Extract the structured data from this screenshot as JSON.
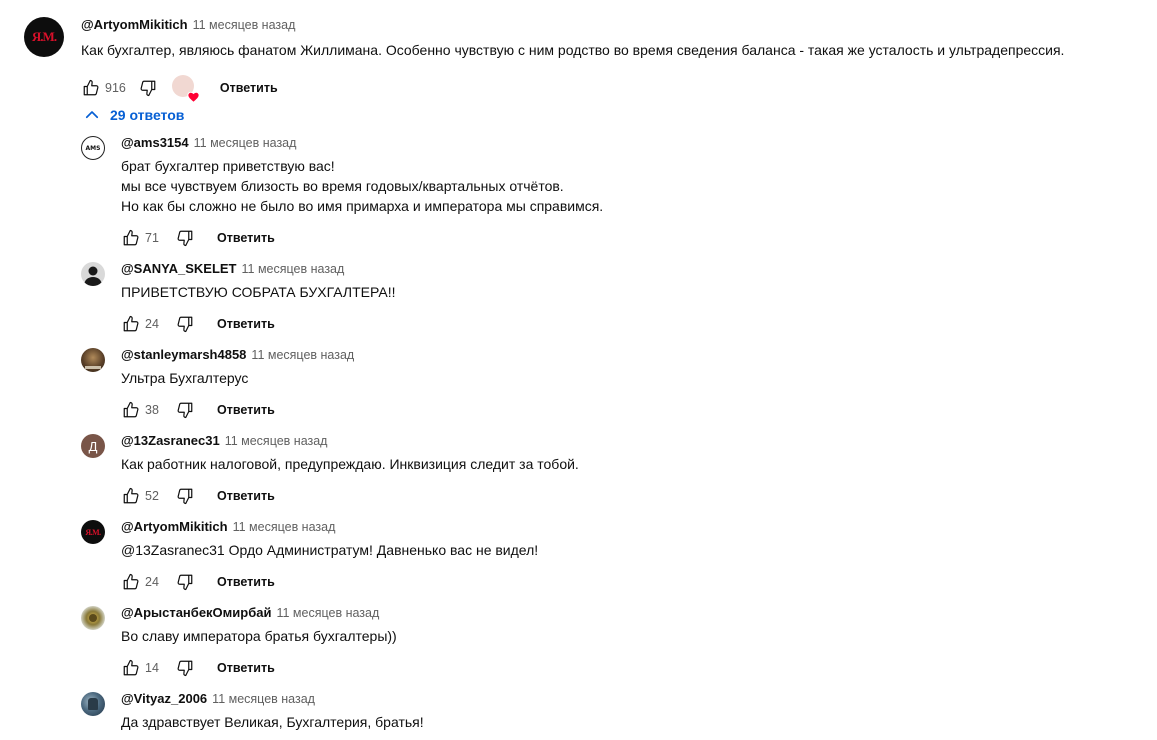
{
  "main_comment": {
    "author": "@ArtyomMikitich",
    "time": "11 месяцев назад",
    "text": "Как бухгалтер, являюсь фанатом Жиллимана. Особенно чувствую с ним родство во время сведения баланса - такая же усталость и ультрадепрессия.",
    "likes": "916",
    "reply_label": "Ответить",
    "avatar_logo": "Я.М."
  },
  "replies_toggle": {
    "label": "29 ответов"
  },
  "replies": [
    {
      "author": "@ams3154",
      "time": "11 месяцев назад",
      "text": "брат бухгалтер приветствую вас!\nмы все чувствуем близость во время годовых/квартальных отчётов.\nНо как бы сложно не было во имя примарха и императора мы справимся.",
      "likes": "71",
      "reply_label": "Ответить",
      "avatar_text": "AMS"
    },
    {
      "author": "@SANYA_SKELET",
      "time": "11 месяцев назад",
      "text": "ПРИВЕТСТВУЮ СОБРАТА БУХГАЛТЕРА!!",
      "likes": "24",
      "reply_label": "Ответить",
      "avatar_text": ""
    },
    {
      "author": "@stanleymarsh4858",
      "time": "11 месяцев назад",
      "text": "Ультра Бухгалтерус",
      "likes": "38",
      "reply_label": "Ответить",
      "avatar_text": ""
    },
    {
      "author": "@13Zasranec31",
      "time": "11 месяцев назад",
      "text": "Как работник налоговой, предупреждаю. Инквизиция следит за тобой.",
      "likes": "52",
      "reply_label": "Ответить",
      "avatar_text": "Д"
    },
    {
      "author": "@ArtyomMikitich",
      "time": "11 месяцев назад",
      "text": "@13Zasranec31  Ордо Администратум! Давненько вас не видел!",
      "likes": "24",
      "reply_label": "Ответить",
      "avatar_text": "Я.М."
    },
    {
      "author": "@АрыстанбекОмирбай",
      "time": "11 месяцев назад",
      "text": "Во славу императора братья бухгалтеры))",
      "likes": "14",
      "reply_label": "Ответить",
      "avatar_text": ""
    },
    {
      "author": "@Vityaz_2006",
      "time": "11 месяцев назад",
      "text": "Да здравствует Великая, Бухгалтерия, братья!",
      "likes": "",
      "reply_label": "",
      "avatar_text": ""
    }
  ],
  "colors": {
    "link_blue": "#065fd4",
    "secondary_text": "#606060",
    "heart_red": "#ff0033"
  },
  "icons": [
    "thumb-up-icon",
    "thumb-down-icon",
    "chevron-up-icon",
    "creator-heart-icon"
  ]
}
